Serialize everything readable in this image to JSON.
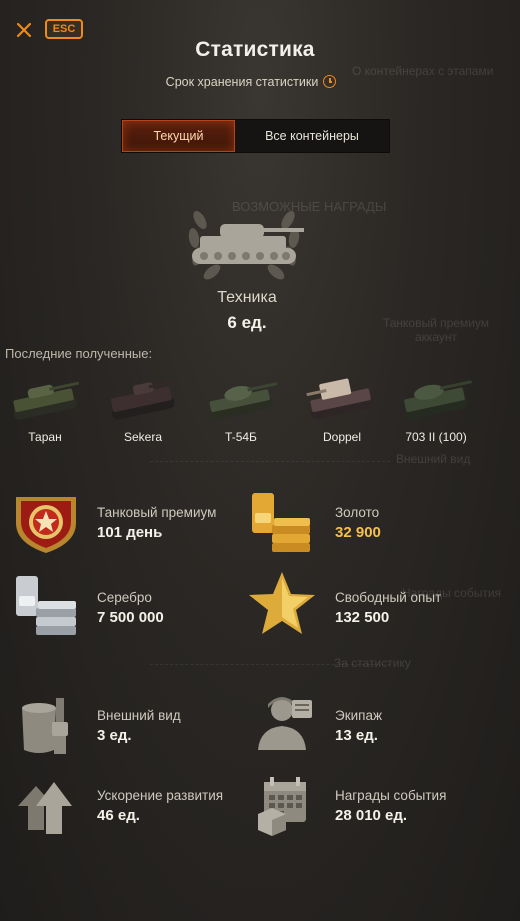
{
  "header": {
    "esc_label": "ESC",
    "title": "Статистика",
    "subtitle": "Срок хранения статистики",
    "ghost_right": "О контейнерах с этапами"
  },
  "tabs": [
    {
      "label": "Текущий",
      "active": true
    },
    {
      "label": "Все контейнеры",
      "active": false
    }
  ],
  "ghost_texts": {
    "possible_rewards": "ВОЗМОЖНЫЕ НАГРАДЫ",
    "premium_ghost": "Танковый премиум аккаунт",
    "appearance_ghost": "Внешний вид",
    "events_ghost": "Награды события",
    "stats_ghost": "За статистику"
  },
  "hero": {
    "label": "Техника",
    "value": "6 ед."
  },
  "recent_label": "Последние полученные:",
  "vehicles": [
    {
      "name": "Таран",
      "color": "#4a5236"
    },
    {
      "name": "Sekera",
      "color": "#3d2f2f"
    },
    {
      "name": "T-54Б",
      "color": "#46503a"
    },
    {
      "name": "Doppel",
      "color": "#5a4646"
    },
    {
      "name": "703 II (100)",
      "color": "#3f4a36"
    }
  ],
  "stats": {
    "premium": {
      "label": "Танковый премиум",
      "value": "101 день",
      "icon": "premium-badge-icon"
    },
    "gold": {
      "label": "Золото",
      "value": "32 900",
      "icon": "gold-bars-icon"
    },
    "silver": {
      "label": "Серебро",
      "value": "7 500 000",
      "icon": "silver-bars-icon"
    },
    "free_xp": {
      "label": "Свободный опыт",
      "value": "132 500",
      "icon": "star-icon"
    },
    "appearance": {
      "label": "Внешний вид",
      "value": "3 ед.",
      "icon": "paint-bucket-icon"
    },
    "crew": {
      "label": "Экипаж",
      "value": "13 ед.",
      "icon": "crew-icon"
    },
    "boosts": {
      "label": "Ускорение развития",
      "value": "46 ед.",
      "icon": "acceleration-arrows-icon"
    },
    "events": {
      "label": "Награды события",
      "value": "28 010 ед.",
      "icon": "calendar-icon"
    }
  },
  "colors": {
    "accent": "#f08a1a",
    "gold_text": "#f5c04a"
  }
}
